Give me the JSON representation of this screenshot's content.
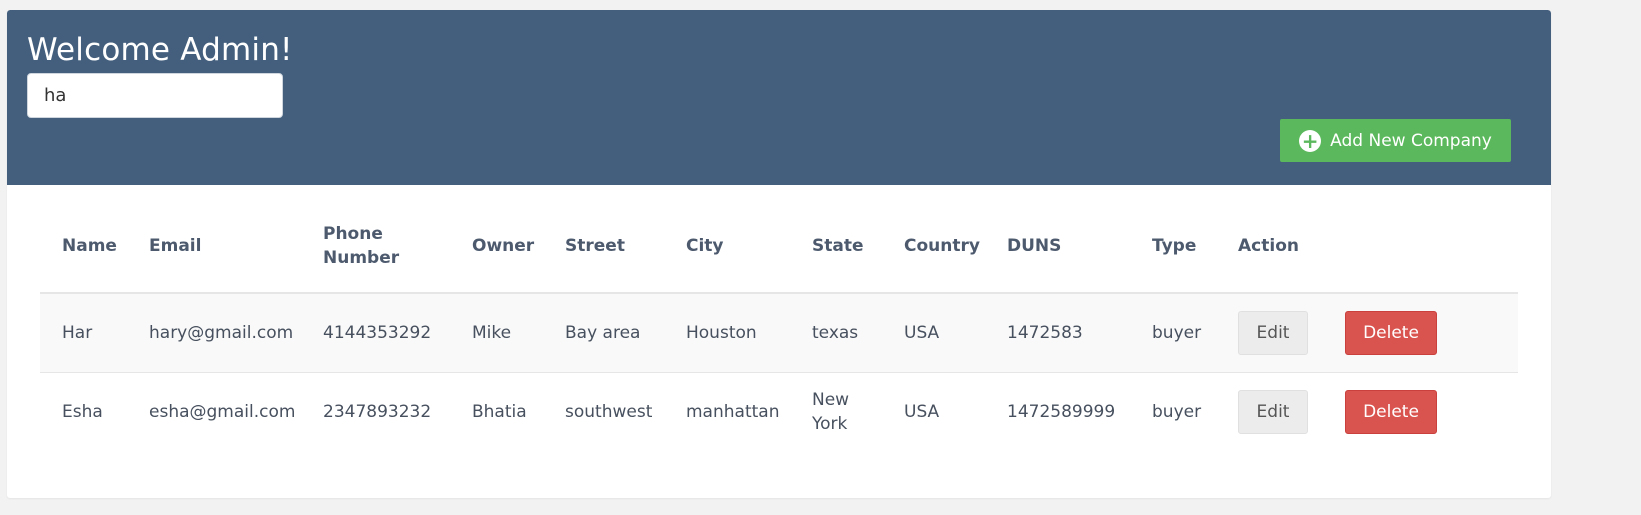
{
  "header": {
    "welcome": "Welcome Admin!",
    "search_value": "ha",
    "add_button_label": "Add New Company",
    "background_color": "#435f7d",
    "add_button_color": "#5cb85c"
  },
  "table": {
    "columns": [
      "Name",
      "Email",
      "Phone Number",
      "Owner",
      "Street",
      "City",
      "State",
      "Country",
      "DUNS",
      "Type",
      "Action"
    ],
    "rows": [
      {
        "name": "Har",
        "email": "hary@gmail.com",
        "phone": "4144353292",
        "owner": "Mike",
        "street": "Bay area",
        "city": "Houston",
        "state": "texas",
        "country": "USA",
        "duns": "1472583",
        "type": "buyer",
        "edit_label": "Edit",
        "delete_label": "Delete"
      },
      {
        "name": "Esha",
        "email": "esha@gmail.com",
        "phone": "2347893232",
        "owner": "Bhatia",
        "street": "southwest",
        "city": "manhattan",
        "state": "New York",
        "country": "USA",
        "duns": "1472589999",
        "type": "buyer",
        "edit_label": "Edit",
        "delete_label": "Delete"
      }
    ],
    "delete_color": "#d9534f"
  }
}
